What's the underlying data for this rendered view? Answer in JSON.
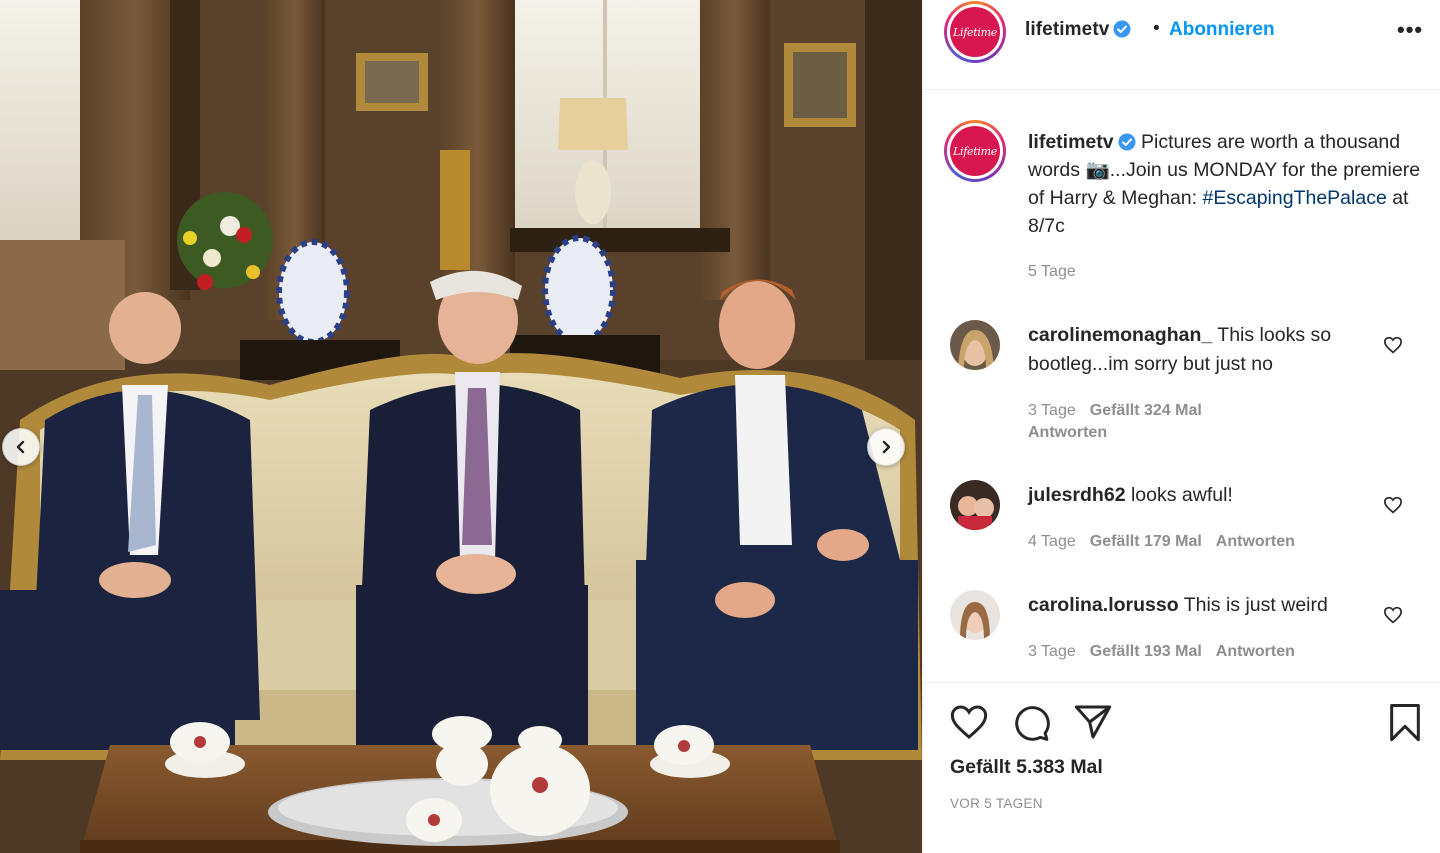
{
  "post": {
    "username": "lifetimetv",
    "follow_label": "Abonnieren",
    "separator": "•",
    "more_label": "•••",
    "logo_text": "Lifetime",
    "caption_lead": "Pictures are worth a thousand words",
    "caption_emoji": "📷",
    "caption_mid": "...Join us MONDAY for the premiere of Harry & Meghan: ",
    "hashtag": "#EscapingThePalace",
    "caption_tail": " at 8/7c",
    "caption_time": "5 Tage",
    "likes": "Gefällt 5.383 Mal",
    "date": "VOR 5 TAGEN"
  },
  "comments": [
    {
      "username": "carolinemonaghan_",
      "text": "This looks so bootleg...im sorry but just no",
      "time": "3 Tage",
      "likes": "Gefällt 324 Mal",
      "reply": "Antworten"
    },
    {
      "username": "julesrdh62",
      "text": "looks awful!",
      "time": "4 Tage",
      "likes": "Gefällt 179 Mal",
      "reply": "Antworten"
    },
    {
      "username": "carolina.lorusso",
      "text": "This is just weird",
      "time": "3 Tage",
      "likes": "Gefällt 193 Mal",
      "reply": "Antworten"
    }
  ],
  "icons": {
    "verified": "verified-badge-icon",
    "heart": "heart-icon",
    "comment": "comment-bubble-icon",
    "share": "paper-plane-icon",
    "save": "bookmark-icon",
    "prev": "chevron-left-icon",
    "next": "chevron-right-icon"
  },
  "colors": {
    "accent": "#0095f6",
    "hashtag": "#00376b",
    "muted": "#8e8e8e",
    "text": "#262626",
    "logo": "#d8164f"
  }
}
